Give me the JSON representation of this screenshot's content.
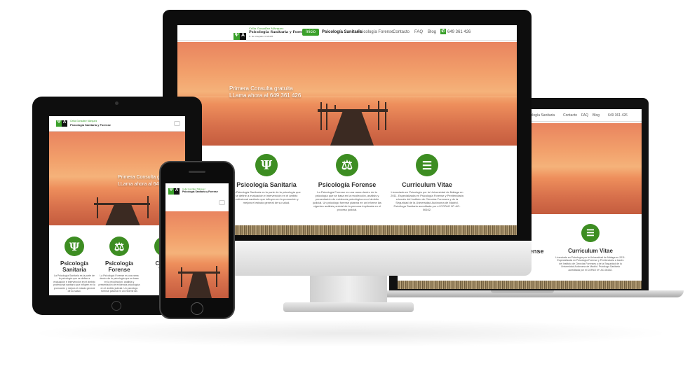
{
  "site": {
    "logo_name": "Celia González Márquez",
    "logo_title": "Psicología Sanitaria y Forense",
    "logo_subtitle": "N. de colegiado: M-26405",
    "mobile_title": "Psicología Sanitaria y Forense"
  },
  "nav": {
    "home": "Inicio",
    "sanitaria": "Psicología Sanitaria",
    "forense": "Psicología Forense",
    "contacto": "Contacto",
    "faq": "FAQ",
    "blog": "Blog",
    "phone": "649 361 426"
  },
  "hero": {
    "line1": "Primera Consulta gratuita",
    "line2": "LLama ahora al 649 361 426",
    "tablet_line1": "Primera Consulta gr",
    "tablet_line2": "LLama ahora al 649"
  },
  "services": [
    {
      "icon": "psi-icon",
      "glyph": "Ψ",
      "title": "Psicología Sanitaria",
      "text": "La Psicología Sanitaria es la parte de la psicología que se define a evaluación e intervención en el ámbito profesional sanitario que influyen en la promoción y mejora el estado general de su salud."
    },
    {
      "icon": "scales-icon",
      "glyph": "⚖",
      "title": "Psicología Forense",
      "text": "La Psicología Forense es una rama dentro de la psicología que se basa en la recolección, análisis y presentación de evidencia psicológica en el ámbito judicial. Un psicólogo forense plasma en un informe las vigentes análisis pericial de la persona implicada en el proceso judicial."
    },
    {
      "icon": "document-icon",
      "glyph": "☰",
      "title": "Curriculum Vitae",
      "text": "Licenciada en Psicología por la Universidad de Málaga en 2011. Especializada en Psicología Forense y Penitenciaria a través del Instituto de Ciencias Forenses y de la Seguridad de la Universidad Autónoma de Madrid. Psicóloga Sanitaria acreditada por el COPAO Nº: AO-06162."
    }
  ],
  "laptop_nav": {
    "sanitaria": "Psicología Sanitaria",
    "forense": "Psicología Forense",
    "contacto": "Contacto",
    "faq": "FAQ",
    "blog": "Blog",
    "phone": "649 361 426"
  },
  "tablet": {
    "title1": "Psicología",
    "title1b": "Sanitaria",
    "title2": "Psicología",
    "title2b": "Forense",
    "title3": "Curr",
    "title3b": "Vi"
  },
  "laptop": {
    "partial_title": "ense"
  },
  "colors": {
    "accent": "#3aa02a",
    "icon_green": "#3d8d22",
    "device_black": "#111111",
    "silver": "#c9c9c9"
  }
}
